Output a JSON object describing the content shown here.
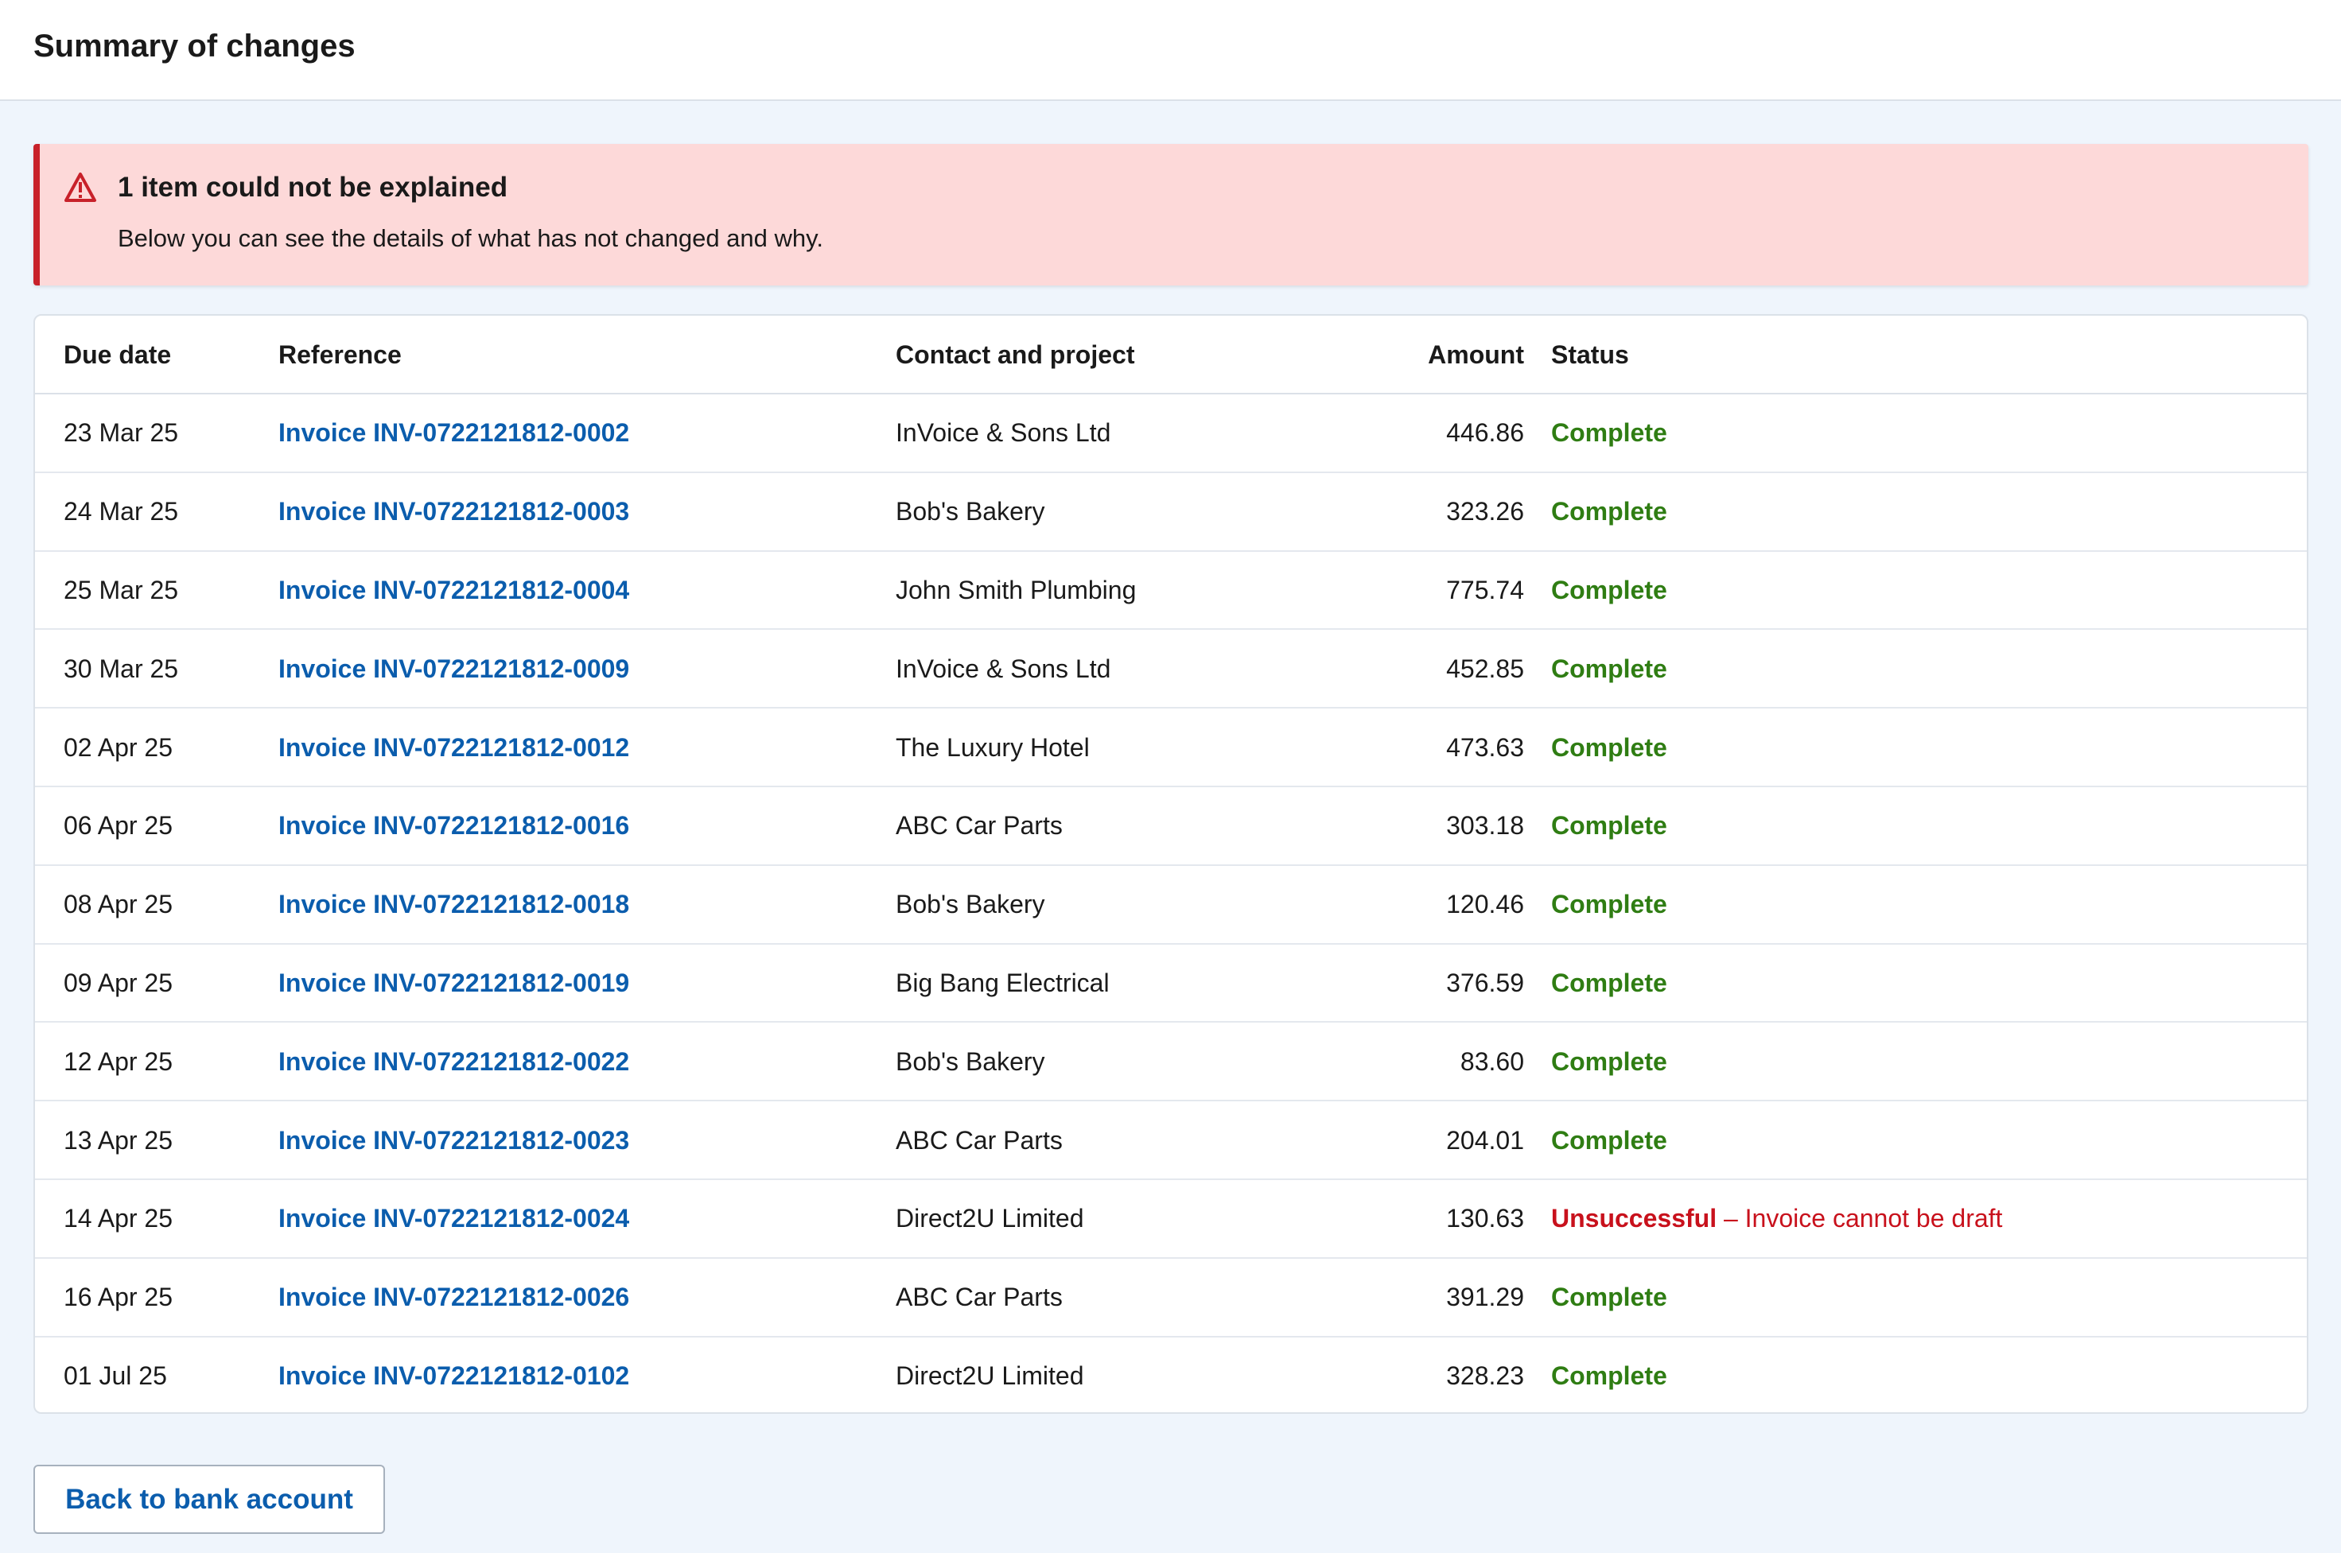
{
  "header": {
    "title": "Summary of changes"
  },
  "alert": {
    "title": "1 item could not be explained",
    "body": "Below you can see the details of what has not changed and why.",
    "icon": "warning-triangle-icon",
    "color": "#c8212a"
  },
  "table": {
    "columns": {
      "due_date": "Due date",
      "reference": "Reference",
      "contact": "Contact and project",
      "amount": "Amount",
      "status": "Status"
    },
    "rows": [
      {
        "due_date": "23 Mar 25",
        "reference": "Invoice INV-0722121812-0002",
        "contact": "InVoice & Sons Ltd",
        "amount": "446.86",
        "status": "Complete",
        "reason": ""
      },
      {
        "due_date": "24 Mar 25",
        "reference": "Invoice INV-0722121812-0003",
        "contact": "Bob's Bakery",
        "amount": "323.26",
        "status": "Complete",
        "reason": ""
      },
      {
        "due_date": "25 Mar 25",
        "reference": "Invoice INV-0722121812-0004",
        "contact": "John Smith Plumbing",
        "amount": "775.74",
        "status": "Complete",
        "reason": ""
      },
      {
        "due_date": "30 Mar 25",
        "reference": "Invoice INV-0722121812-0009",
        "contact": "InVoice & Sons Ltd",
        "amount": "452.85",
        "status": "Complete",
        "reason": ""
      },
      {
        "due_date": "02 Apr 25",
        "reference": "Invoice INV-0722121812-0012",
        "contact": "The Luxury Hotel",
        "amount": "473.63",
        "status": "Complete",
        "reason": ""
      },
      {
        "due_date": "06 Apr 25",
        "reference": "Invoice INV-0722121812-0016",
        "contact": "ABC Car Parts",
        "amount": "303.18",
        "status": "Complete",
        "reason": ""
      },
      {
        "due_date": "08 Apr 25",
        "reference": "Invoice INV-0722121812-0018",
        "contact": "Bob's Bakery",
        "amount": "120.46",
        "status": "Complete",
        "reason": ""
      },
      {
        "due_date": "09 Apr 25",
        "reference": "Invoice INV-0722121812-0019",
        "contact": "Big Bang Electrical",
        "amount": "376.59",
        "status": "Complete",
        "reason": ""
      },
      {
        "due_date": "12 Apr 25",
        "reference": "Invoice INV-0722121812-0022",
        "contact": "Bob's Bakery",
        "amount": "83.60",
        "status": "Complete",
        "reason": ""
      },
      {
        "due_date": "13 Apr 25",
        "reference": "Invoice INV-0722121812-0023",
        "contact": "ABC Car Parts",
        "amount": "204.01",
        "status": "Complete",
        "reason": ""
      },
      {
        "due_date": "14 Apr 25",
        "reference": "Invoice INV-0722121812-0024",
        "contact": "Direct2U Limited",
        "amount": "130.63",
        "status": "Unsuccessful",
        "reason": " – Invoice cannot be draft"
      },
      {
        "due_date": "16 Apr 25",
        "reference": "Invoice INV-0722121812-0026",
        "contact": "ABC Car Parts",
        "amount": "391.29",
        "status": "Complete",
        "reason": ""
      },
      {
        "due_date": "01 Jul 25",
        "reference": "Invoice INV-0722121812-0102",
        "contact": "Direct2U Limited",
        "amount": "328.23",
        "status": "Complete",
        "reason": ""
      }
    ]
  },
  "colors": {
    "link": "#0b5dad",
    "complete": "#2f7d13",
    "unsuccessful": "#c8111c",
    "alert_background": "#fdd9d9"
  },
  "actions": {
    "back_label": "Back to bank account"
  }
}
